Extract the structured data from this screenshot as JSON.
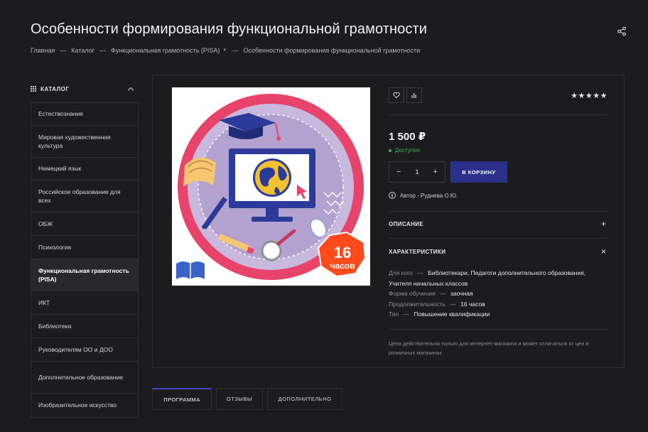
{
  "header": {
    "title": "Особенности формирования функциональной грамотности",
    "share_icon": "share-icon"
  },
  "breadcrumb": {
    "items": [
      "Главная",
      "Каталог",
      "Функциональная грамотность (PISA)",
      "Особенности формирования функциональной грамотности"
    ],
    "separator": "—",
    "dropdown_icon": "caret-down-icon"
  },
  "sidebar": {
    "title": "КАТАЛОГ",
    "items": [
      {
        "label": "Естествознание",
        "active": false
      },
      {
        "label": "Мировая художественная культура",
        "active": false
      },
      {
        "label": "Немецкий язык",
        "active": false
      },
      {
        "label": "Российское образование для всех",
        "active": false
      },
      {
        "label": "ОБЖ",
        "active": false
      },
      {
        "label": "Психология",
        "active": false
      },
      {
        "label": "Функциональная грамотность (PISA)",
        "active": true
      },
      {
        "label": "ИКТ",
        "active": false
      },
      {
        "label": "Библиотека",
        "active": false
      },
      {
        "label": "Руководителям ОО и ДОО",
        "active": false
      },
      {
        "label": "Дополнительное образование",
        "active": false
      },
      {
        "label": "Изобразительное искусство",
        "active": false
      }
    ]
  },
  "product": {
    "badge_number": "16",
    "badge_unit": "часов",
    "rating": "★★★★★",
    "price": "1 500 ₽",
    "availability": "Доступно",
    "quantity": "1",
    "qty_minus": "−",
    "qty_plus": "+",
    "add_to_cart": "В КОРЗИНУ",
    "author_label": "Автор - Руднева О.Ю.",
    "info_glyph": "i",
    "description_title": "ОПИСАНИЕ",
    "description_toggle": "+",
    "characteristics_title": "ХАРАКТЕРИСТИКИ",
    "characteristics_toggle": "×",
    "characteristics": [
      {
        "key": "Для кого",
        "value": "Библиотекари, Педагоги дополнительного образования, Учителя начальных классов"
      },
      {
        "key": "Форма обучения",
        "value": "заочная"
      },
      {
        "key": "Продолжительность",
        "value": "16 часов"
      },
      {
        "key": "Тип",
        "value": "Повышение квалификации"
      }
    ],
    "kv_separator": "—",
    "price_note": "Цена действительна только для интернет-магазина и может отличаться от цен в розничных магазинах",
    "accent_color": "#2c2f8c"
  },
  "tabs": [
    {
      "label": "ПРОГРАММА",
      "active": true
    },
    {
      "label": "ОТЗЫВЫ",
      "active": false
    },
    {
      "label": "ДОПОЛНИТЕЛЬНО",
      "active": false
    }
  ]
}
